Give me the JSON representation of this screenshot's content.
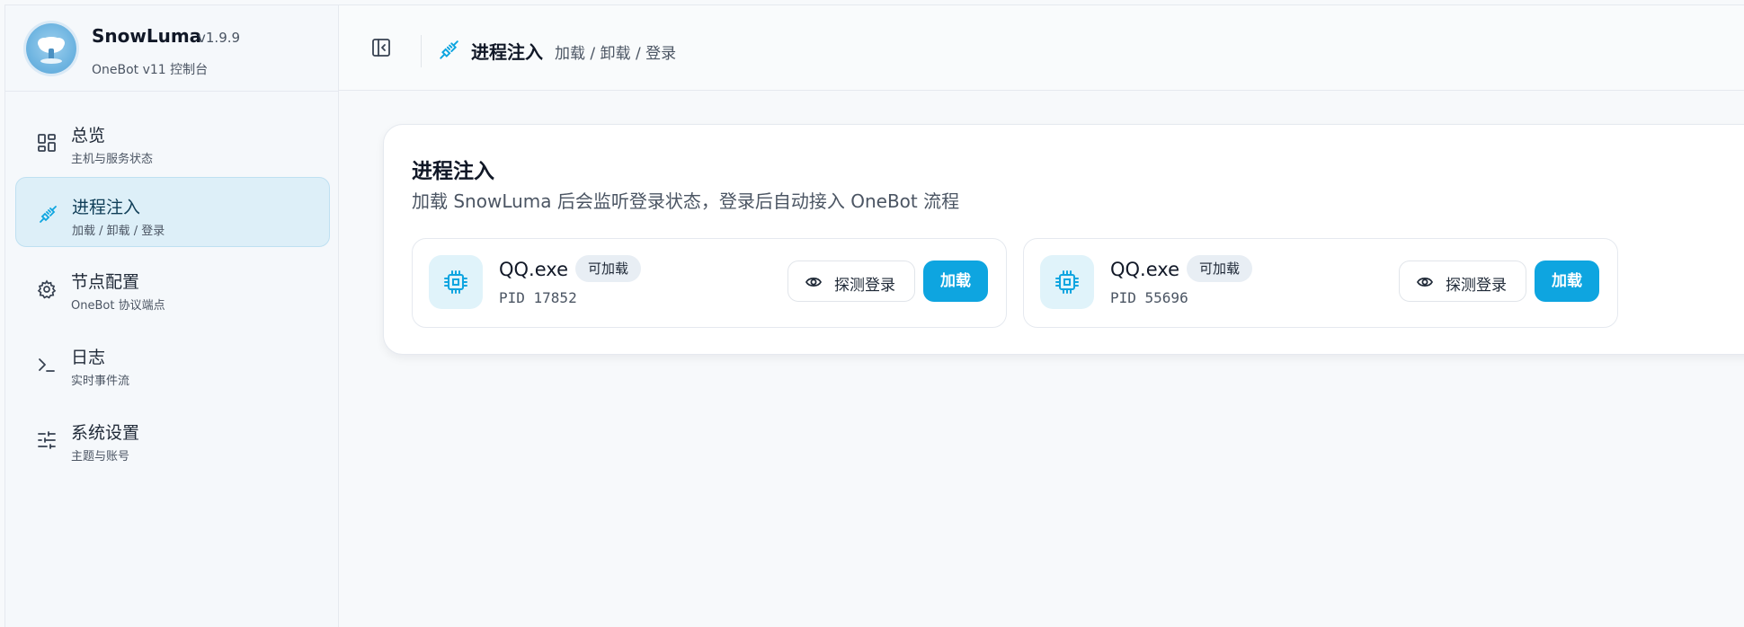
{
  "brand": {
    "name": "SnowLuma",
    "version": "v1.9.9",
    "subtitle": "OneBot v11 控制台"
  },
  "sidebar": {
    "items": [
      {
        "title": "总览",
        "subtitle": "主机与服务状态",
        "icon": "dashboard-icon",
        "active": false
      },
      {
        "title": "进程注入",
        "subtitle": "加载 / 卸载 / 登录",
        "icon": "plug-icon",
        "active": true
      },
      {
        "title": "节点配置",
        "subtitle": "OneBot 协议端点",
        "icon": "gear-icon",
        "active": false
      },
      {
        "title": "日志",
        "subtitle": "实时事件流",
        "icon": "terminal-icon",
        "active": false
      },
      {
        "title": "系统设置",
        "subtitle": "主题与账号",
        "icon": "sliders-icon",
        "active": false
      }
    ]
  },
  "topbar": {
    "title": "进程注入",
    "subtitle": "加载 / 卸载 / 登录"
  },
  "main": {
    "title": "进程注入",
    "description": "加载 SnowLuma 后会监听登录状态，登录后自动接入 OneBot 流程",
    "processes": [
      {
        "name": "QQ.exe",
        "badge": "可加载",
        "pid": "PID 17852",
        "probe_label": "探测登录",
        "load_label": "加载"
      },
      {
        "name": "QQ.exe",
        "badge": "可加载",
        "pid": "PID 55696",
        "probe_label": "探测登录",
        "load_label": "加载"
      }
    ]
  },
  "colors": {
    "accent": "#0ea5e0",
    "active_nav_bg": "#ddeff8",
    "badge_bg": "#e8eef4"
  }
}
